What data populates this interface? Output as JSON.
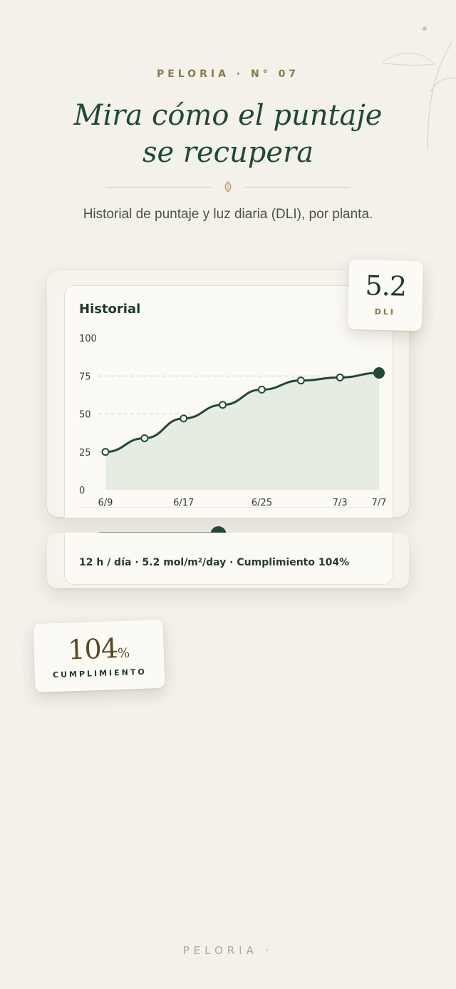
{
  "header": {
    "eyebrow": "PELORIA · N° 07",
    "title_line1": "Mira cómo el puntaje",
    "title_line2": "se recupera",
    "subtitle": "Historial de puntaje y luz diaria (DLI), por planta."
  },
  "chart_card": {
    "title": "Historial",
    "stats_line": "12 h / día · 5.2 mol/m²/day · Cumplimiento 104%"
  },
  "chart_data": {
    "type": "area",
    "title": "Historial",
    "x": [
      "6/9",
      "6/13",
      "6/17",
      "6/21",
      "6/25",
      "6/29",
      "7/3",
      "7/7"
    ],
    "x_tick_labels": [
      "6/9",
      "6/17",
      "6/25",
      "7/3",
      "7/7"
    ],
    "series": [
      {
        "values": [
          25,
          34,
          47,
          56,
          66,
          72,
          74,
          77
        ]
      }
    ],
    "ylim": [
      0,
      100
    ],
    "y_ticks": [
      0,
      25,
      50,
      75,
      100
    ],
    "grid": "dashed horizontal",
    "colors": {
      "line": "#1f4a33",
      "fill": "#e6ece1",
      "grid": "#cfd3c8"
    }
  },
  "slider": {
    "value_fraction": 0.46,
    "color": "#1f4a33"
  },
  "badge_dli": {
    "value": "5.2",
    "label": "DLI"
  },
  "badge_cumplimiento": {
    "value": "104",
    "unit": "%",
    "label": "CUMPLIMIENTO"
  },
  "footer": {
    "brand": "PELORIA ·"
  },
  "icons": {
    "divider": "leaf-icon",
    "decoration": "branch-icon"
  }
}
